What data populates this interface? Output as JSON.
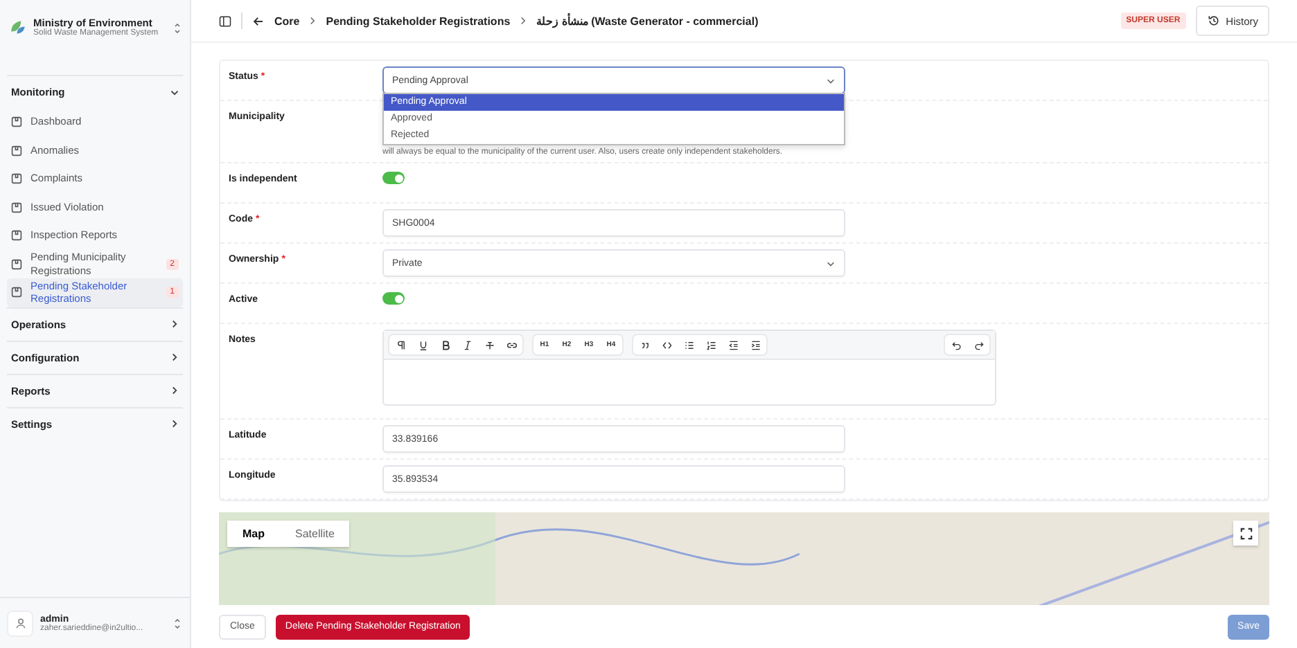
{
  "app": {
    "title": "Ministry of Environment",
    "subtitle": "Solid Waste Management System"
  },
  "sidebar": {
    "sections": [
      {
        "label": "Monitoring",
        "expanded": true,
        "items": [
          {
            "label": "Dashboard",
            "selected": false
          },
          {
            "label": "Anomalies",
            "selected": false
          },
          {
            "label": "Complaints",
            "selected": false
          },
          {
            "label": "Issued Violation",
            "selected": false
          },
          {
            "label": "Inspection Reports",
            "selected": false
          },
          {
            "label": "Pending Municipality Registrations",
            "badge": "2",
            "selected": false
          },
          {
            "label": "Pending Stakeholder Registrations",
            "badge": "1",
            "selected": true
          }
        ]
      },
      {
        "label": "Operations",
        "expanded": false
      },
      {
        "label": "Configuration",
        "expanded": false
      },
      {
        "label": "Reports",
        "expanded": false
      },
      {
        "label": "Settings",
        "expanded": false
      }
    ]
  },
  "user": {
    "name": "admin",
    "email": "zaher.sarieddine@in2ultio..."
  },
  "breadcrumb": [
    "Core",
    "Pending Stakeholder Registrations",
    "منشأة زحلة (Waste Generator - commercial)"
  ],
  "role_badge": "SUPER USER",
  "history_button": "History",
  "form": {
    "fields": [
      {
        "kind": "select",
        "label": "Status",
        "required_mark": "*",
        "value": "Pending Approval",
        "open": true,
        "options": [
          {
            "label": "Pending Approval",
            "selected": true
          },
          {
            "label": "Approved",
            "selected": false
          },
          {
            "label": "Rejected",
            "selected": false
          }
        ]
      },
      {
        "kind": "hint",
        "label": "Municipality",
        "hint": "will always be equal to the municipality of the current user. Also, users create only independent stakeholders."
      },
      {
        "kind": "toggle",
        "label": "Is independent",
        "on": true
      },
      {
        "kind": "input",
        "label": "Code",
        "required_mark": "*",
        "value": "SHG0004"
      },
      {
        "kind": "select",
        "label": "Ownership",
        "required_mark": "*",
        "value": "Private",
        "open": false
      },
      {
        "kind": "toggle",
        "label": "Active",
        "on": true
      },
      {
        "kind": "editor",
        "label": "Notes",
        "headings": [
          "H1",
          "H2",
          "H3",
          "H4"
        ]
      },
      {
        "kind": "input",
        "label": "Latitude",
        "value": "33.839166"
      },
      {
        "kind": "input",
        "label": "Longitude",
        "value": "35.893534"
      }
    ]
  },
  "map": {
    "tabs": [
      {
        "label": "Map",
        "selected": true
      },
      {
        "label": "Satellite",
        "selected": false
      }
    ]
  },
  "footer": {
    "close": "Close",
    "delete": "Delete Pending Stakeholder Registration",
    "save": "Save",
    "save_disabled": true
  }
}
